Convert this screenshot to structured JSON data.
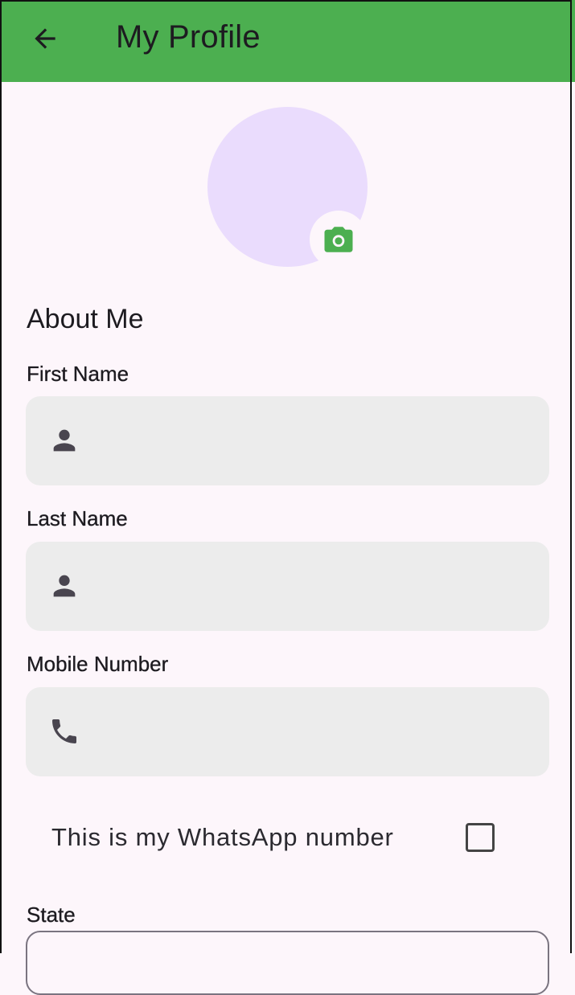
{
  "appbar": {
    "title": "My Profile",
    "back_icon": "arrow-back-icon"
  },
  "avatar": {
    "camera_icon": "camera-icon"
  },
  "about": {
    "heading": "About Me"
  },
  "fields": {
    "first_name": {
      "label": "First Name",
      "value": "",
      "icon": "person-icon"
    },
    "last_name": {
      "label": "Last Name",
      "value": "",
      "icon": "person-icon"
    },
    "mobile": {
      "label": "Mobile Number",
      "value": "",
      "icon": "phone-icon"
    }
  },
  "whatsapp": {
    "label": "This is my WhatsApp number",
    "checked": false
  },
  "state": {
    "label": "State",
    "value": ""
  },
  "colors": {
    "primary": "#4caf50",
    "background": "#fdf6fb",
    "field_fill": "#ececec",
    "avatar_fill": "#eadcfd",
    "icon": "#49454f"
  }
}
